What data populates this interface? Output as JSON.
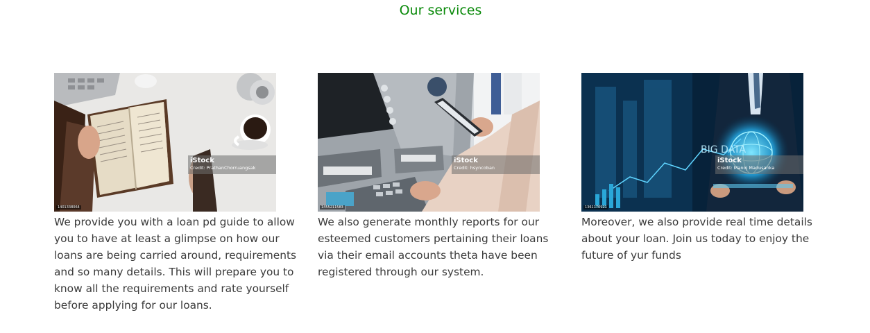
{
  "section": {
    "title": "Our services"
  },
  "services": [
    {
      "image_watermark_brand": "iStock",
      "image_watermark_credit": "Credit: PrathanChorruangsak",
      "image_id": "1401338064",
      "description": "We provide you with a loan pd guide to allow you to have at least a glimpse on how our loans are being carried around, requirements and so many details. This will prepare you to know all the requirements and rate yourself before applying for our loans."
    },
    {
      "image_watermark_brand": "iStock",
      "image_watermark_credit": "Credit: hsyncoban",
      "image_id": "1455211583",
      "description": "We also generate monthly reports for our esteemed customers pertaining their loans via their email accounts theta have been registered through our system."
    },
    {
      "image_watermark_brand": "iStock",
      "image_watermark_credit": "Credit: Manoj Madusanka",
      "image_id": "1361170921",
      "description": "Moreover, we also provide real time details about your loan. Join us today to enjoy the future of yur funds"
    }
  ],
  "colors": {
    "title": "#0a8a0a",
    "text": "#3a3a3a"
  }
}
